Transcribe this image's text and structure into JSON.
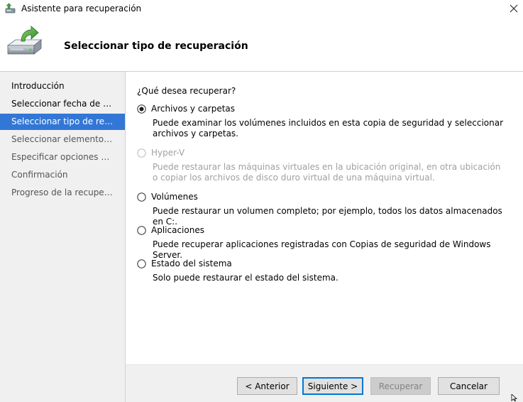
{
  "window": {
    "title": "Asistente para recuperación",
    "close_icon": "close-icon",
    "app_icon": "wizard-app-icon"
  },
  "header": {
    "title": "Seleccionar tipo de recuperación",
    "icon": "backup-restore-icon"
  },
  "sidebar": {
    "items": [
      {
        "label": "Introducción",
        "state": "normal"
      },
      {
        "label": "Seleccionar fecha de copia de seguridad",
        "state": "normal"
      },
      {
        "label": "Seleccionar tipo de recuperación",
        "state": "active"
      },
      {
        "label": "Seleccionar elementos que recuperar",
        "state": "pending"
      },
      {
        "label": "Especificar opciones de recuperación",
        "state": "pending"
      },
      {
        "label": "Confirmación",
        "state": "pending"
      },
      {
        "label": "Progreso de la recuperación",
        "state": "pending"
      }
    ]
  },
  "main": {
    "question": "¿Qué desea recuperar?",
    "options": [
      {
        "label": "Archivos y carpetas",
        "description": "Puede examinar los volúmenes incluidos en esta copia de seguridad y seleccionar archivos y carpetas.",
        "checked": true,
        "enabled": true
      },
      {
        "label": "Hyper-V",
        "description": "Puede restaurar las máquinas virtuales en la ubicación original, en otra ubicación o copiar los archivos de disco duro virtual de una máquina virtual.",
        "checked": false,
        "enabled": false
      },
      {
        "label": "Volúmenes",
        "description": "Puede restaurar un volumen completo; por ejemplo, todos los datos almacenados en C:.",
        "checked": false,
        "enabled": true
      },
      {
        "label": "Aplicaciones",
        "description": "Puede recuperar aplicaciones registradas con Copias de seguridad de Windows Server.",
        "checked": false,
        "enabled": true
      },
      {
        "label": "Estado del sistema",
        "description": "Solo puede restaurar el estado del sistema.",
        "checked": false,
        "enabled": true
      }
    ]
  },
  "footer": {
    "back_label": "< Anterior",
    "next_label": "Siguiente >",
    "recover_label": "Recuperar",
    "cancel_label": "Cancelar"
  },
  "colors": {
    "accent": "#3377d6",
    "sidebar_bg": "#f0f0f0",
    "disabled_text": "#a0a0a0"
  }
}
